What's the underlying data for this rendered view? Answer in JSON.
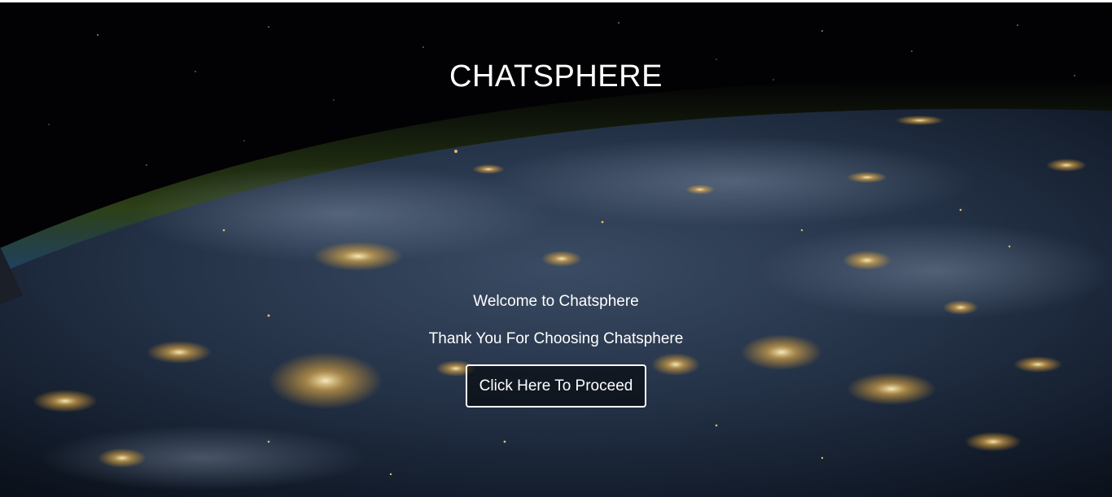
{
  "colors": {
    "text": "#ffffff",
    "background": "#000000"
  },
  "hero": {
    "background_image": "earth-at-night-from-space"
  },
  "header": {
    "title": "CHATSPHERE"
  },
  "main": {
    "welcome_text": "Welcome to Chatsphere",
    "thanks_text": "Thank You For Choosing Chatsphere",
    "proceed_label": "Click Here To Proceed"
  }
}
